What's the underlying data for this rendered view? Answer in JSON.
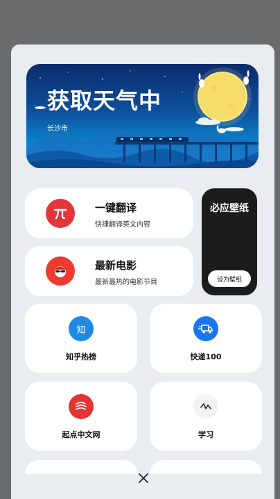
{
  "weather": {
    "title": "获取天气中",
    "city": "长沙市"
  },
  "features": [
    {
      "title": "一键翻译",
      "subtitle": "快捷翻译英文内容",
      "icon": "pi-icon",
      "color": "#e2363b"
    },
    {
      "title": "最新电影",
      "subtitle": "最新最热的电影节目",
      "icon": "movie-face-icon",
      "color": "#ef3a2f"
    }
  ],
  "wallpaper": {
    "title": "必应壁纸",
    "button": "设为壁纸"
  },
  "grid": [
    {
      "label": "知乎热榜",
      "icon": "zhihu-icon",
      "color": "#1e88e5",
      "glyph": "知"
    },
    {
      "label": "快递100",
      "icon": "delivery-truck-icon",
      "color": "#1976f0",
      "glyph": ""
    },
    {
      "label": "起点中文网",
      "icon": "qidian-icon",
      "color": "#e23434",
      "glyph": ""
    },
    {
      "label": "学习",
      "icon": "study-icon",
      "color": "#f3f3f3",
      "glyph": ""
    }
  ]
}
